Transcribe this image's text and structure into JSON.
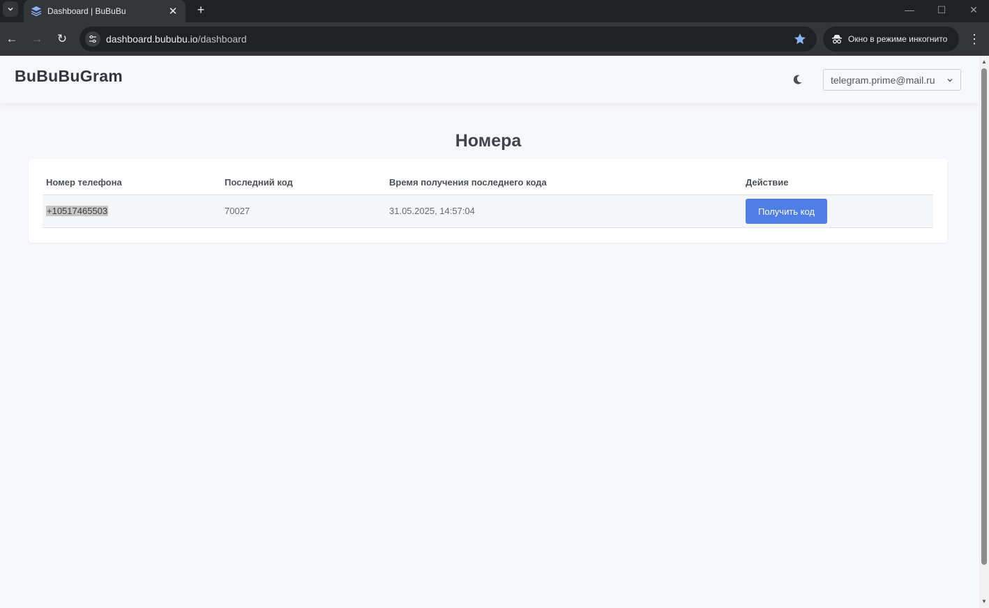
{
  "browser": {
    "tab_title": "Dashboard | BuBuBu",
    "url_domain": "dashboard.bububu.io",
    "url_path": "/dashboard",
    "incognito_label": "Окно в режиме инкогнито"
  },
  "header": {
    "brand": "BuBuBuGram",
    "account": "telegram.prime@mail.ru"
  },
  "main": {
    "title": "Номера",
    "columns": [
      "Номер телефона",
      "Последний код",
      "Время получения последнего кода",
      "Действие"
    ],
    "rows": [
      {
        "phone": "+10517465503",
        "last_code": "70027",
        "received_at": "31.05.2025, 14:57:04",
        "action_label": "Получить код"
      }
    ]
  },
  "colors": {
    "accent": "#4e7ee6",
    "page_bg": "#f7f8fc",
    "chrome_dark": "#202124"
  }
}
